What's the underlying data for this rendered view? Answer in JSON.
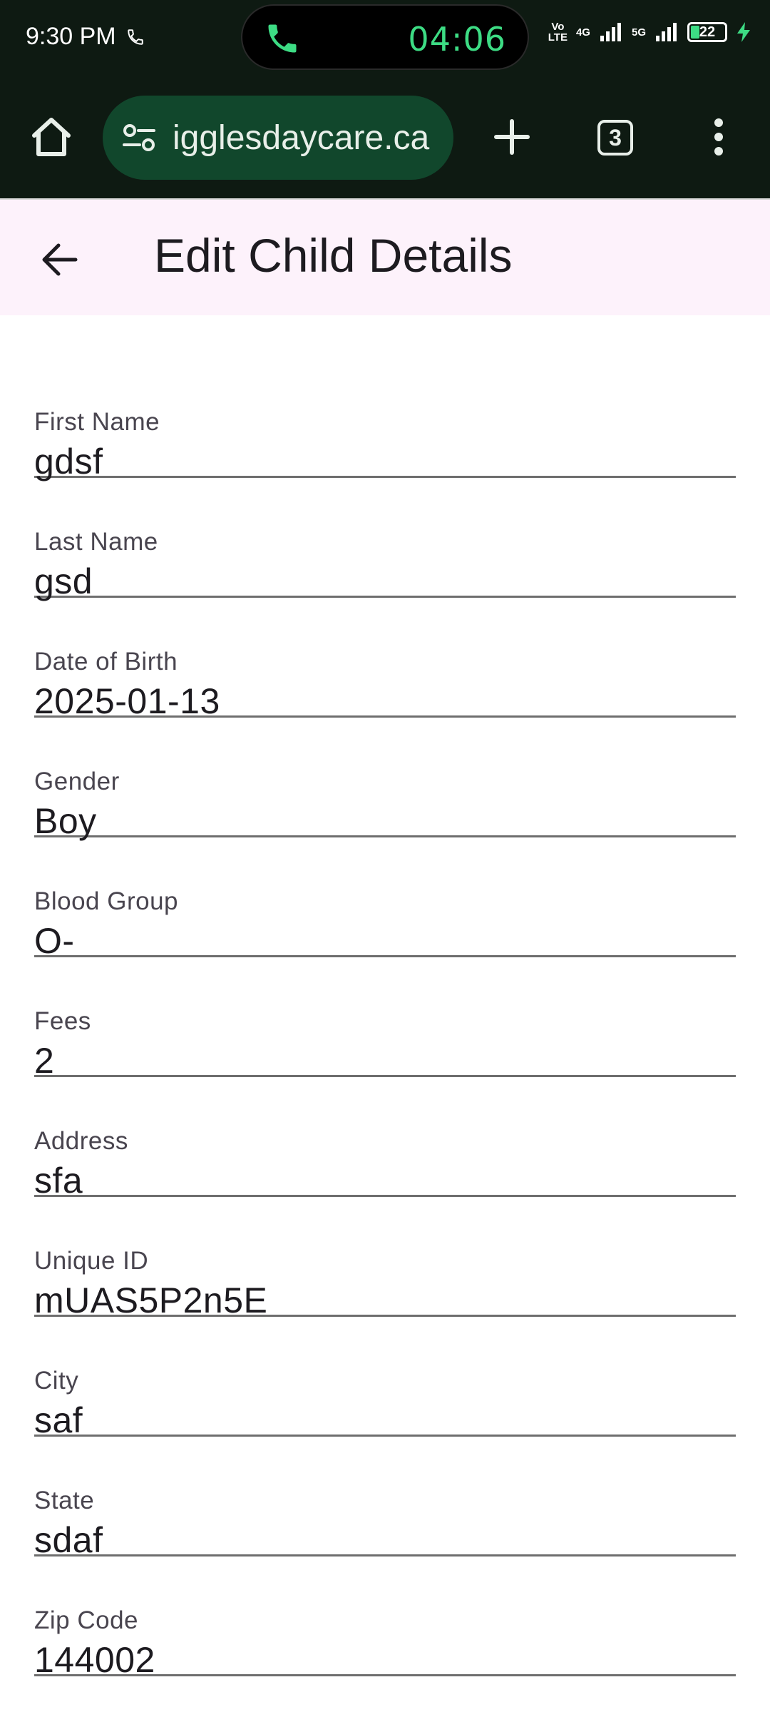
{
  "status_bar": {
    "time": "9:30 PM",
    "call_timer": "04:06",
    "net_left": [
      "Vo",
      "LTE"
    ],
    "net_4g": "4G",
    "net_5g": "5G",
    "battery": "22"
  },
  "browser": {
    "url": "igglesdaycare.ca",
    "tab_count": "3"
  },
  "app_bar": {
    "title": "Edit Child Details"
  },
  "form": {
    "fields": [
      {
        "label": "First Name",
        "value": "gdsf"
      },
      {
        "label": "Last Name",
        "value": "gsd"
      },
      {
        "label": "Date of Birth",
        "value": "2025-01-13"
      },
      {
        "label": "Gender",
        "value": "Boy"
      },
      {
        "label": "Blood Group",
        "value": "O-"
      },
      {
        "label": "Fees",
        "value": "2"
      },
      {
        "label": "Address",
        "value": "sfa"
      },
      {
        "label": "Unique ID",
        "value": "mUAS5P2n5E"
      },
      {
        "label": "City",
        "value": "saf"
      },
      {
        "label": "State",
        "value": "sdaf"
      },
      {
        "label": "Zip Code",
        "value": "144002"
      }
    ]
  },
  "colors": {
    "status_bg": "#0e1a12",
    "url_pill": "#11472c",
    "call_green": "#3ddc84",
    "app_bar_bg": "#fdf2fb"
  }
}
